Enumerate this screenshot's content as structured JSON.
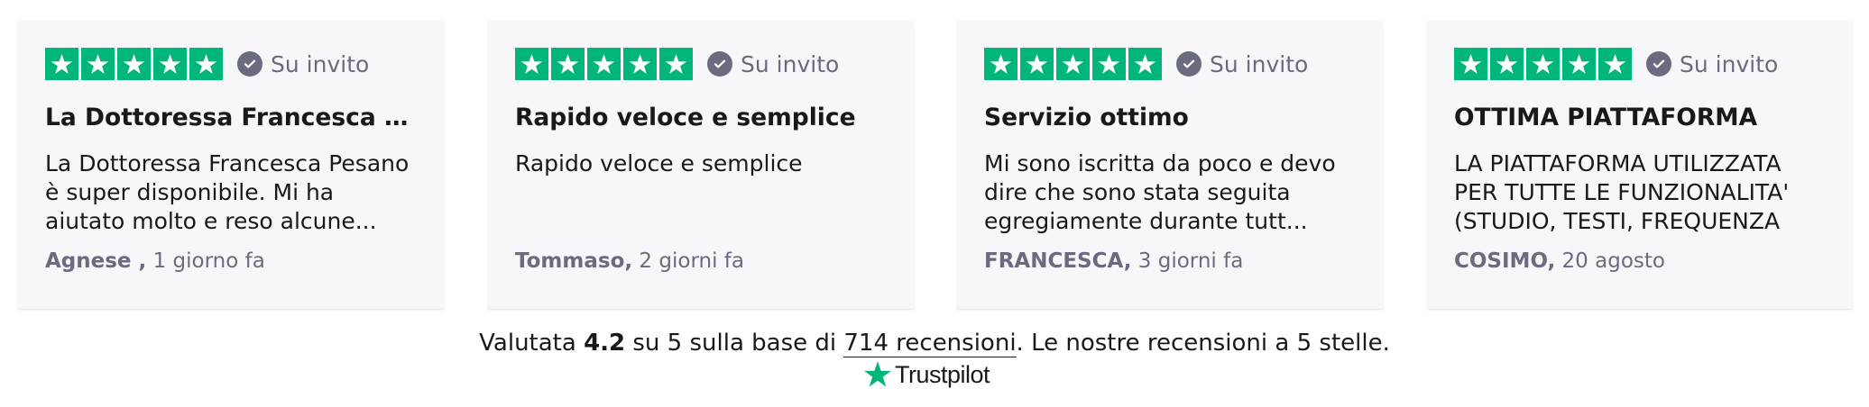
{
  "reviews": [
    {
      "rating": 5,
      "badge": "Su invito",
      "title": "La Dottoressa Francesca Pe...",
      "body": "La Dottoressa Francesca Pesano è super disponibile. Mi ha aiutato molto e reso alcune...",
      "author": "Agnese ,",
      "date": " 1 giorno fa"
    },
    {
      "rating": 5,
      "badge": "Su invito",
      "title": "Rapido veloce e semplice",
      "body": "Rapido veloce e semplice",
      "author": "Tommaso,",
      "date": " 2 giorni fa"
    },
    {
      "rating": 5,
      "badge": "Su invito",
      "title": "Servizio ottimo",
      "body": "Mi sono iscritta da poco e devo dire che sono stata seguita egregiamente durante tutt...",
      "author": "FRANCESCA,",
      "date": " 3 giorni fa"
    },
    {
      "rating": 5,
      "badge": "Su invito",
      "title": "OTTIMA PIATTAFORMA",
      "body": "LA PIATTAFORMA UTILIZZATA PER TUTTE LE FUNZIONALITA' (STUDIO, TESTI, FREQUENZA",
      "author": "COSIMO,",
      "date": " 20 agosto"
    }
  ],
  "summary": {
    "prefix": "Valutata ",
    "score": "4.2",
    "middle": " su 5 sulla base di ",
    "reviews_link": "714 recensioni",
    "suffix": ". Le nostre recensioni a 5 stelle."
  },
  "brand": {
    "name": "Trustpilot",
    "icon": "trustpilot-star-icon"
  },
  "icons": {
    "star": "star-icon",
    "verified": "check-circle-icon"
  },
  "colors": {
    "star_green": "#00b67a",
    "card_bg": "#f7f7f9",
    "muted_text": "#6b6b80",
    "text": "#191919"
  }
}
